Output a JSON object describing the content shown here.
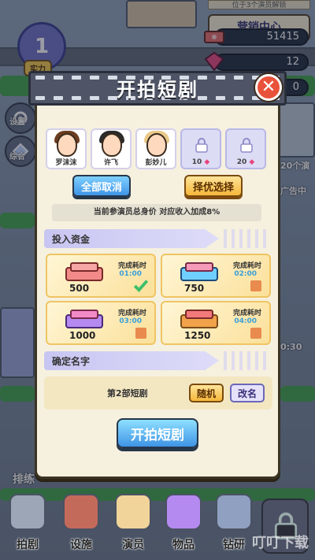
{
  "hud": {
    "news_text": "位于3个演员解锁",
    "power_value": "1",
    "power_label": "实力",
    "panel_title": "营销中心",
    "money": "51415",
    "gems": "12",
    "third_resource": "0"
  },
  "side": {
    "settings": "设置",
    "general": "综合",
    "rank": "排练",
    "right_banner_1": "20个演",
    "right_banner_2": "广告中",
    "right_time": "0:30"
  },
  "modal": {
    "title": "开拍短剧",
    "actors": [
      {
        "name": "罗沫沫",
        "locked": false,
        "hair": "#6b3e1f"
      },
      {
        "name": "许飞",
        "locked": false,
        "hair": "#2b2b2b"
      },
      {
        "name": "彭妙儿",
        "locked": false,
        "hair": "#e9c98a"
      },
      {
        "name": "",
        "locked": true,
        "cost": "10"
      },
      {
        "name": "",
        "locked": true,
        "cost": "20"
      }
    ],
    "cancel_all": "全部取消",
    "select_best": "择优选择",
    "info": "当前参演员总身价 对应收入加成8%",
    "fund_section": "投入资金",
    "funds": [
      {
        "amount": "500",
        "time_label": "完成耗时",
        "time": "01:00",
        "selected": true
      },
      {
        "amount": "750",
        "time_label": "完成耗时",
        "time": "02:00",
        "selected": false
      },
      {
        "amount": "1000",
        "time_label": "完成耗时",
        "time": "03:00",
        "selected": false
      },
      {
        "amount": "1250",
        "time_label": "完成耗时",
        "time": "04:00",
        "selected": false
      }
    ],
    "name_section": "确定名字",
    "drama_name": "第2部短剧",
    "random": "随机",
    "rename": "改名",
    "start": "开拍短剧"
  },
  "nav": {
    "items": [
      "拍剧",
      "设施",
      "演员",
      "物品",
      "钻研"
    ]
  },
  "watermark": "叮叮下载"
}
